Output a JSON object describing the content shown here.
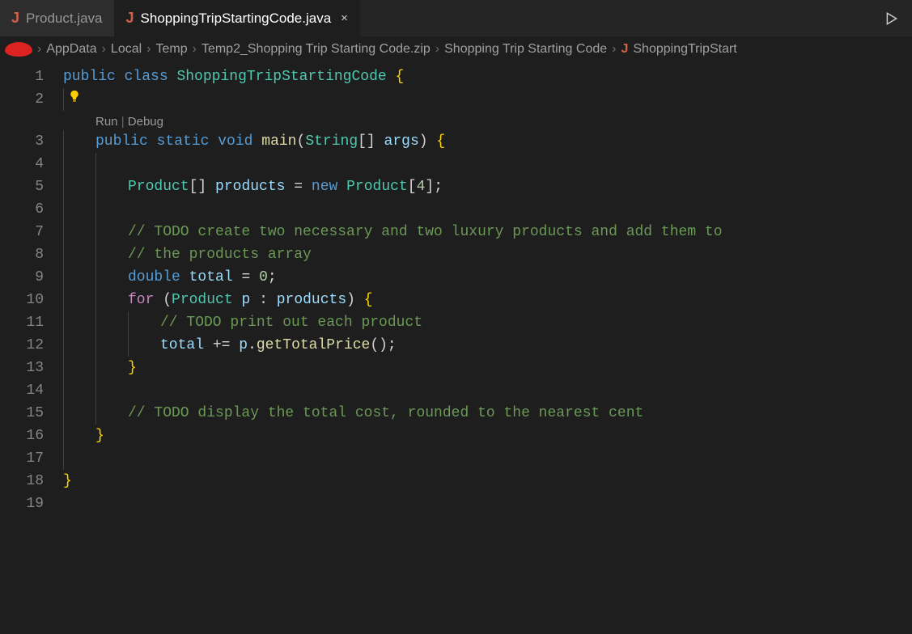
{
  "tabs": [
    {
      "icon": "J",
      "label": "Product.java"
    },
    {
      "icon": "J",
      "label": "ShoppingTripStartingCode.java",
      "close": "×"
    }
  ],
  "breadcrumb": [
    "AppData",
    "Local",
    "Temp",
    "Temp2_Shopping Trip Starting Code.zip",
    "Shopping Trip Starting Code"
  ],
  "breadcrumb_file_icon": "J",
  "breadcrumb_file": "ShoppingTripStart",
  "codelens": {
    "run": "Run",
    "debug": "Debug"
  },
  "line_numbers": [
    "1",
    "2",
    "3",
    "4",
    "5",
    "6",
    "7",
    "8",
    "9",
    "10",
    "11",
    "12",
    "13",
    "14",
    "15",
    "16",
    "17",
    "18",
    "19"
  ],
  "code": {
    "l1_kw1": "public",
    "l1_kw2": "class",
    "l1_type": "ShoppingTripStartingCode",
    "l1_br": "{",
    "l3_kw1": "public",
    "l3_kw2": "static",
    "l3_kw3": "void",
    "l3_fn": "main",
    "l3_p1": "(",
    "l3_type": "String",
    "l3_arr": "[]",
    "l3_var": "args",
    "l3_p2": ")",
    "l3_br": "{",
    "l5_type": "Product",
    "l5_arr": "[]",
    "l5_var": "products",
    "l5_eq": "=",
    "l5_new": "new",
    "l5_type2": "Product",
    "l5_b1": "[",
    "l5_num": "4",
    "l5_b2": "]",
    "l5_semi": ";",
    "l7_com": "// TODO create two necessary and two luxury products and add them to",
    "l8_com": "// the products array",
    "l9_kw": "double",
    "l9_var": "total",
    "l9_eq": "=",
    "l9_num": "0",
    "l9_semi": ";",
    "l10_for": "for",
    "l10_p1": "(",
    "l10_type": "Product",
    "l10_var": "p",
    "l10_colon": ":",
    "l10_var2": "products",
    "l10_p2": ")",
    "l10_br": "{",
    "l11_com": "// TODO print out each product",
    "l12_var": "total",
    "l12_op": "+=",
    "l12_var2": "p",
    "l12_dot": ".",
    "l12_fn": "getTotalPrice",
    "l12_par": "()",
    "l12_semi": ";",
    "l13_br": "}",
    "l15_com": "// TODO display the total cost, rounded to the nearest cent",
    "l16_br": "}",
    "l18_br": "}"
  }
}
